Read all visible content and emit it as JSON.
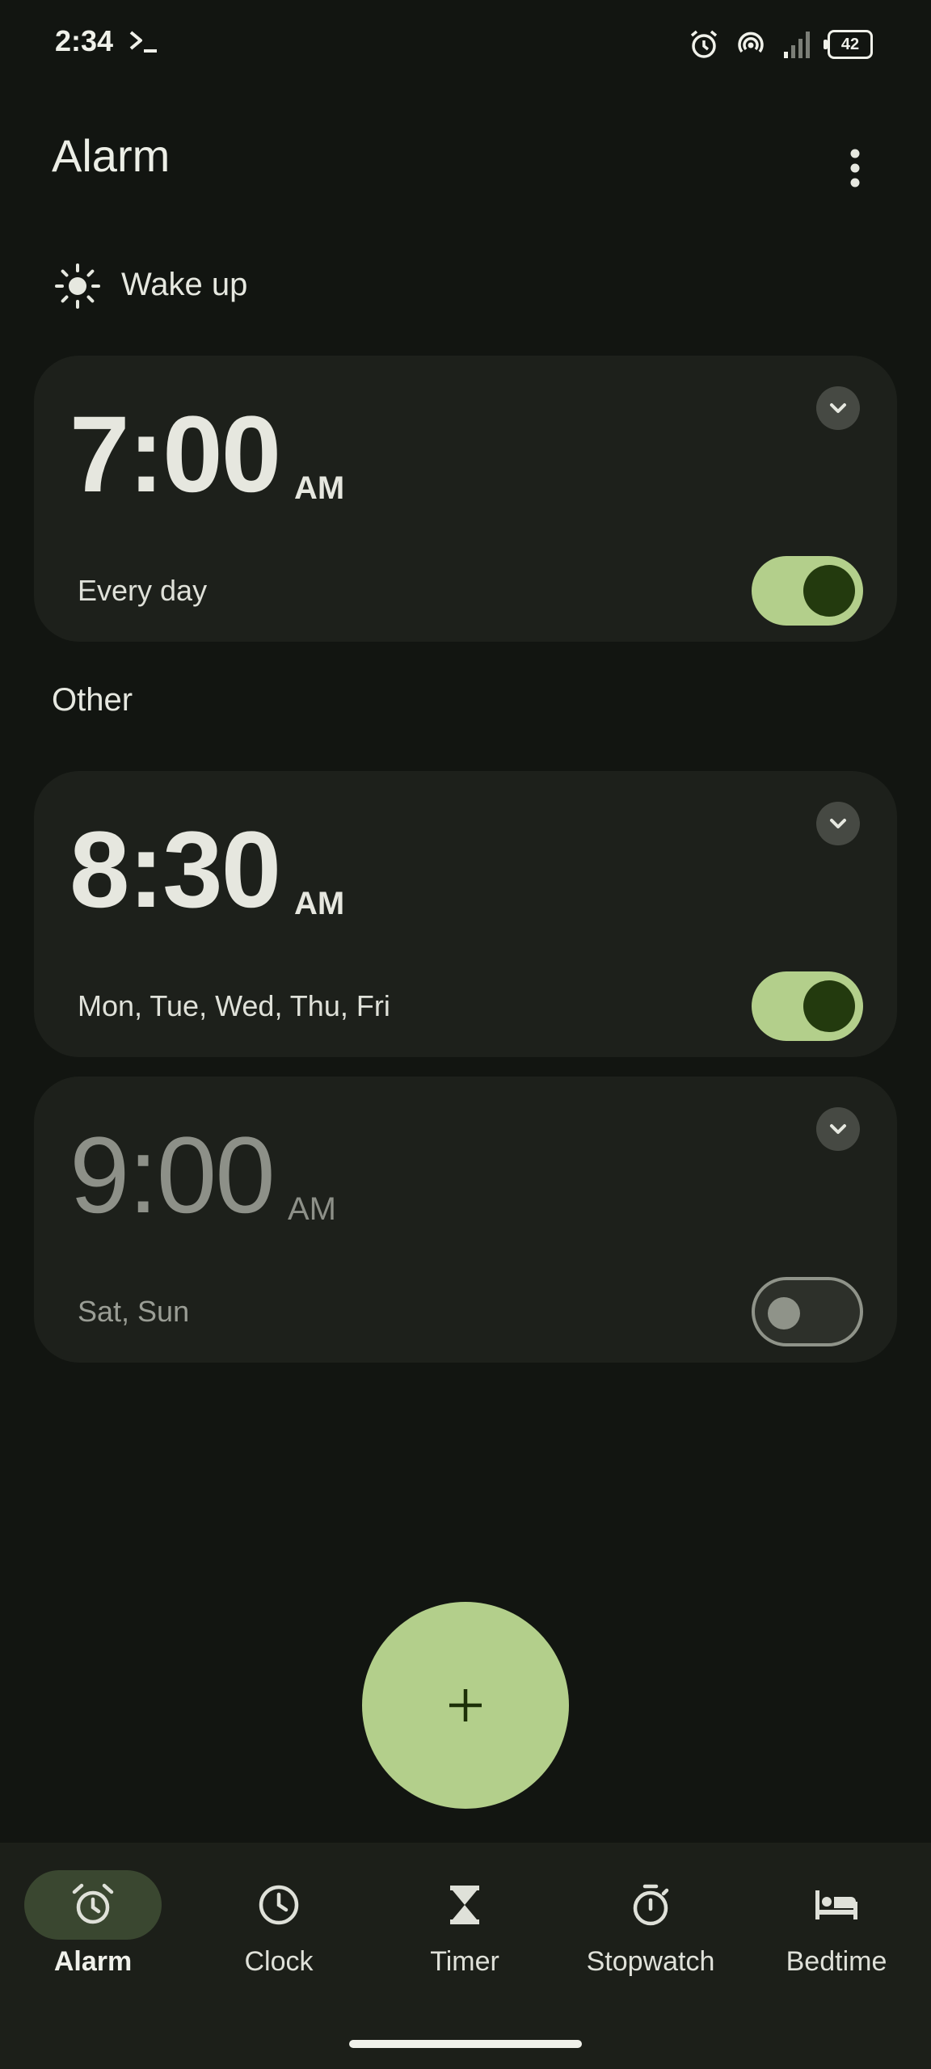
{
  "status": {
    "time": "2:34",
    "battery": "42"
  },
  "header": {
    "title": "Alarm"
  },
  "sections": {
    "wake_up": "Wake up",
    "other": "Other"
  },
  "alarms": [
    {
      "time": "7:00",
      "ampm": "AM",
      "days": "Every day",
      "enabled": true
    },
    {
      "time": "8:30",
      "ampm": "AM",
      "days": "Mon, Tue, Wed, Thu, Fri",
      "enabled": true
    },
    {
      "time": "9:00",
      "ampm": "AM",
      "days": "Sat, Sun",
      "enabled": false
    }
  ],
  "fab": {
    "icon": "plus-icon"
  },
  "nav": {
    "items": [
      {
        "label": "Alarm",
        "icon": "alarm-icon",
        "active": true
      },
      {
        "label": "Clock",
        "icon": "clock-icon",
        "active": false
      },
      {
        "label": "Timer",
        "icon": "hourglass-icon",
        "active": false
      },
      {
        "label": "Stopwatch",
        "icon": "stopwatch-icon",
        "active": false
      },
      {
        "label": "Bedtime",
        "icon": "bed-icon",
        "active": false
      }
    ]
  },
  "colors": {
    "background": "#121511",
    "card": "#1d201b",
    "accent": "#b3cf8b",
    "accent_dark": "#233a0e"
  }
}
